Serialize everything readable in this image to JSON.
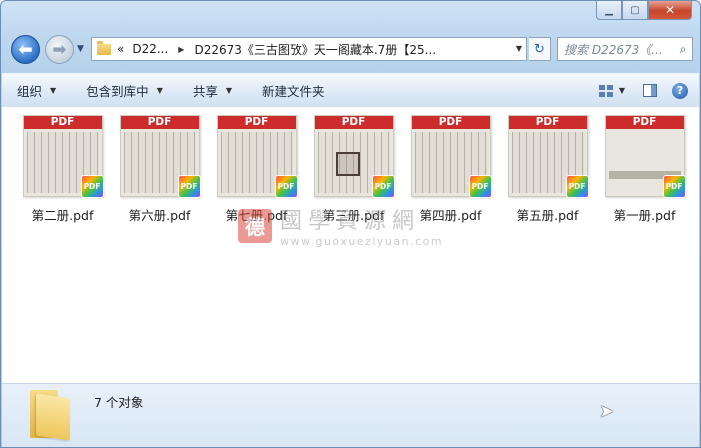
{
  "window": {
    "minimize_glyph": "▁",
    "maximize_glyph": "▢",
    "close_glyph": "✕"
  },
  "nav": {
    "back_glyph": "⬅",
    "forward_glyph": "➡",
    "history_glyph": "▼"
  },
  "address": {
    "overflow_glyph": "«",
    "crumbs": [
      "D22...",
      "D22673《三古图攷》天一阁藏本.7册【25..."
    ],
    "sep_glyph": "▶",
    "drop_glyph": "▼",
    "refresh_glyph": "↻"
  },
  "search": {
    "placeholder": "搜索 D22673《...",
    "icon": "search-icon",
    "icon_glyph": "⌕"
  },
  "toolbar": {
    "organize": "组织",
    "include_in_library": "包含到库中",
    "share": "共享",
    "new_folder": "新建文件夹",
    "dropdown_glyph": "▼",
    "help_glyph": "?"
  },
  "files": [
    {
      "name": "第二册.pdf",
      "badge": "PDF",
      "thumb_label": "PDF",
      "thumb_style": "scan"
    },
    {
      "name": "第六册.pdf",
      "badge": "PDF",
      "thumb_label": "PDF",
      "thumb_style": "scan"
    },
    {
      "name": "第七册.pdf",
      "badge": "PDF",
      "thumb_label": "PDF",
      "thumb_style": "scan"
    },
    {
      "name": "第三册.pdf",
      "badge": "PDF",
      "thumb_label": "PDF",
      "thumb_style": "seal"
    },
    {
      "name": "第四册.pdf",
      "badge": "PDF",
      "thumb_label": "PDF",
      "thumb_style": "scan"
    },
    {
      "name": "第五册.pdf",
      "badge": "PDF",
      "thumb_label": "PDF",
      "thumb_style": "scan"
    },
    {
      "name": "第一册.pdf",
      "badge": "PDF",
      "thumb_label": "PDF",
      "thumb_style": "pink"
    }
  ],
  "watermark": {
    "seal": "德",
    "text": "國學資源網",
    "url": "www.guoxueziyuan.com"
  },
  "status": {
    "count_text": "7 个对象"
  },
  "colors": {
    "pdf_bar": "#cc2c2c",
    "accent": "#2a6fc5"
  }
}
